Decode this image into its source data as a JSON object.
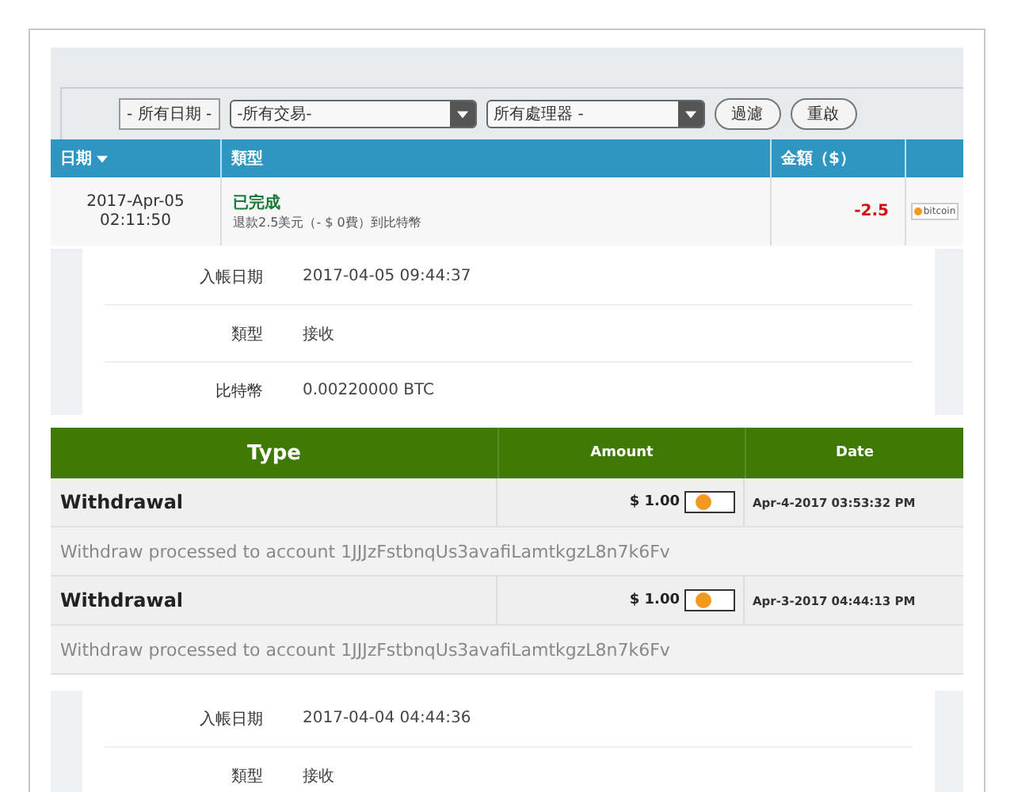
{
  "filter_panel": {
    "date_filter": "- 所有日期 -",
    "type_select": "-所有交易-",
    "processor_select": "所有處理器 -",
    "buttons": [
      "過濾",
      "重啟"
    ]
  },
  "transactions_table": {
    "columns": [
      {
        "label": "日期",
        "sorted": true
      },
      {
        "label": "類型",
        "sorted": false
      },
      {
        "label": "金額（$）",
        "sorted": false
      }
    ],
    "rows": [
      {
        "date": "2017-Apr-05",
        "time": "02:11:50",
        "status": "已完成",
        "description": "退款2.5美元（- $ 0費）到比特幣",
        "amount": "-2.5",
        "method_logo": "bitcoin"
      }
    ]
  },
  "detail_card_1": {
    "fields": [
      {
        "label": "入帳日期",
        "value": "2017-04-05 09:44:37"
      },
      {
        "label": "類型",
        "value": "接收"
      },
      {
        "label": "比特幣",
        "value": "0.00220000 BTC"
      }
    ]
  },
  "withdrawals": {
    "columns": [
      "Type",
      "Amount",
      "Date"
    ],
    "rows": [
      {
        "type": "Withdrawal",
        "amount": "$ 1.00",
        "date": "Apr-4-2017 03:53:32 PM",
        "note": "Withdraw processed to account 1JJJzFstbnqUs3avafiLamtkgzL8n7k6Fv"
      },
      {
        "type": "Withdrawal",
        "amount": "$ 1.00",
        "date": "Apr-3-2017 04:44:13 PM",
        "note": "Withdraw processed to account 1JJJzFstbnqUs3avafiLamtkgzL8n7k6Fv"
      }
    ]
  },
  "detail_card_2": {
    "fields": [
      {
        "label": "入帳日期",
        "value": "2017-04-04 04:44:36"
      },
      {
        "label": "類型",
        "value": "接收"
      }
    ]
  }
}
